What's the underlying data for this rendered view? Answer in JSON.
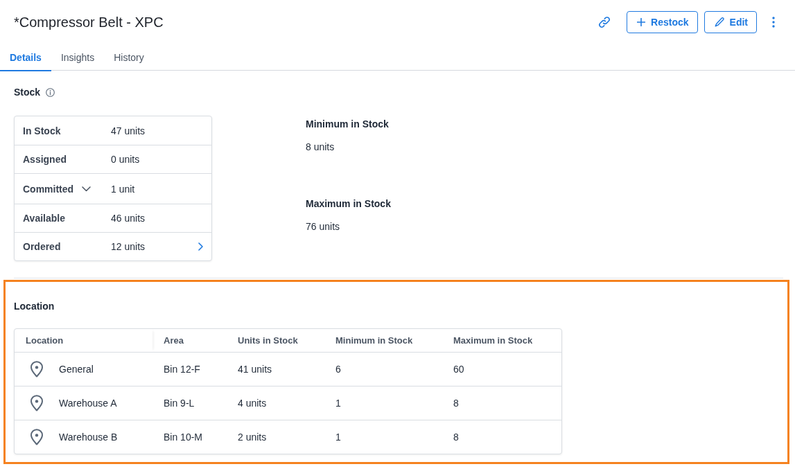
{
  "header": {
    "title": "*Compressor Belt - XPC",
    "buttons": [
      {
        "kind": "restock",
        "label": "Restock"
      },
      {
        "kind": "edit",
        "label": "Edit"
      }
    ]
  },
  "tabs": [
    {
      "label": "Details",
      "selected": true
    },
    {
      "label": "Insights",
      "selected": false
    },
    {
      "label": "History",
      "selected": false
    }
  ],
  "stock": {
    "heading": "Stock",
    "rows": [
      {
        "kind": "plain",
        "label": "In Stock",
        "value": "47 units"
      },
      {
        "kind": "plain",
        "label": "Assigned",
        "value": "0 units"
      },
      {
        "kind": "expandable",
        "label": "Committed",
        "value": "1 unit",
        "expanded": false
      },
      {
        "kind": "plain",
        "label": "Available",
        "value": "46 units"
      },
      {
        "kind": "link",
        "label": "Ordered",
        "value": "12 units"
      }
    ],
    "limits": [
      {
        "label": "Minimum in Stock",
        "value": "8 units"
      },
      {
        "label": "Maximum in Stock",
        "value": "76 units"
      }
    ]
  },
  "location": {
    "heading": "Location",
    "highlighted": true,
    "table": {
      "columns": [
        "Location",
        "Area",
        "Units in Stock",
        "Minimum in Stock",
        "Maximum in Stock"
      ],
      "rows": [
        {
          "location": "General",
          "area": "Bin 12-F",
          "units_in_stock": "41 units",
          "minimum": "6",
          "maximum": "60"
        },
        {
          "location": "Warehouse A",
          "area": "Bin 9-L",
          "units_in_stock": "4 units",
          "minimum": "1",
          "maximum": "8"
        },
        {
          "location": "Warehouse B",
          "area": "Bin 10-M",
          "units_in_stock": "2 units",
          "minimum": "1",
          "maximum": "8"
        }
      ]
    }
  }
}
